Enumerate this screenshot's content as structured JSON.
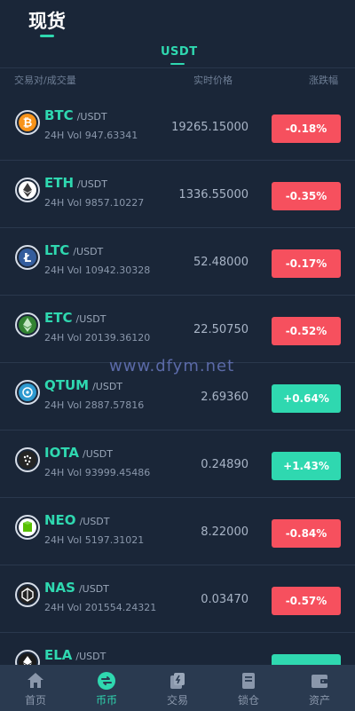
{
  "header": {
    "title": "现货",
    "market_tab": "USDT"
  },
  "columns": {
    "pair": "交易对/成交量",
    "price": "实时价格",
    "change": "涨跌幅"
  },
  "coins": [
    {
      "symbol": "BTC",
      "quote": "/USDT",
      "volume": "24H Vol 947.63341",
      "price": "19265.15000",
      "change": "-0.18%",
      "direction": "down",
      "icon": "bitcoin-icon",
      "color": "#f7931a"
    },
    {
      "symbol": "ETH",
      "quote": "/USDT",
      "volume": "24H Vol 9857.10227",
      "price": "1336.55000",
      "change": "-0.35%",
      "direction": "down",
      "icon": "ethereum-icon",
      "color": "#ffffff"
    },
    {
      "symbol": "LTC",
      "quote": "/USDT",
      "volume": "24H Vol 10942.30328",
      "price": "52.48000",
      "change": "-0.17%",
      "direction": "down",
      "icon": "litecoin-icon",
      "color": "#345d9d"
    },
    {
      "symbol": "ETC",
      "quote": "/USDT",
      "volume": "24H Vol 20139.36120",
      "price": "22.50750",
      "change": "-0.52%",
      "direction": "down",
      "icon": "ethereum-classic-icon",
      "color": "#328332"
    },
    {
      "symbol": "QTUM",
      "quote": "/USDT",
      "volume": "24H Vol 2887.57816",
      "price": "2.69360",
      "change": "+0.64%",
      "direction": "up",
      "icon": "qtum-icon",
      "color": "#2e9ad0"
    },
    {
      "symbol": "IOTA",
      "quote": "/USDT",
      "volume": "24H Vol 93999.45486",
      "price": "0.24890",
      "change": "+1.43%",
      "direction": "up",
      "icon": "iota-icon",
      "color": "#242424"
    },
    {
      "symbol": "NEO",
      "quote": "/USDT",
      "volume": "24H Vol 5197.31021",
      "price": "8.22000",
      "change": "-0.84%",
      "direction": "down",
      "icon": "neo-icon",
      "color": "#58bf00"
    },
    {
      "symbol": "NAS",
      "quote": "/USDT",
      "volume": "24H Vol 201554.24321",
      "price": "0.03470",
      "change": "-0.57%",
      "direction": "down",
      "icon": "nebulas-icon",
      "color": "#222222"
    },
    {
      "symbol": "ELA",
      "quote": "/USDT",
      "volume": "",
      "price": "",
      "change": "",
      "direction": "up",
      "icon": "elastos-icon",
      "color": "#1a1a1a"
    }
  ],
  "watermark": "www.dfym.net",
  "tabbar": [
    {
      "label": "首页",
      "icon": "home-icon"
    },
    {
      "label": "币币",
      "icon": "coin-exchange-icon"
    },
    {
      "label": "交易",
      "icon": "trade-icon"
    },
    {
      "label": "锁仓",
      "icon": "lock-position-icon"
    },
    {
      "label": "资产",
      "icon": "wallet-icon"
    }
  ],
  "colors": {
    "background": "#1a2638",
    "accent": "#2fd8b0",
    "down": "#f6505e",
    "up": "#2fd8b0",
    "tabbar": "#2a3a50"
  },
  "active_tab": 1
}
